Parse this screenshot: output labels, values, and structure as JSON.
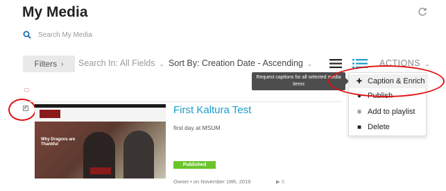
{
  "page": {
    "title": "My Media"
  },
  "search": {
    "placeholder": "Search My Media"
  },
  "toolbar": {
    "filters_label": "Filters",
    "search_in": "Search In: All Fields",
    "sort_by": "Sort By: Creation Date - Ascending",
    "actions_label": "ACTIONS"
  },
  "tooltip": {
    "text": "Request captions for all selected media items"
  },
  "actions_menu": {
    "items": [
      {
        "label": "Caption & Enrich",
        "icon": "plus-icon"
      },
      {
        "label": "Publish",
        "icon": "globe-icon"
      },
      {
        "label": "Add to playlist",
        "icon": "playlist-add-icon"
      },
      {
        "label": "Delete",
        "icon": "trash-icon"
      }
    ]
  },
  "media_entry": {
    "selected": true,
    "title": "First Kaltura Test",
    "description": "first day at MSUM",
    "status": "Published",
    "meta": "Owner • on November 18th, 2019",
    "plays": "5",
    "thumbnail": {
      "headline": "Why Dragons are Thankful"
    }
  },
  "colors": {
    "accent_blue": "#1b9cc9",
    "published_green": "#6ac42a",
    "annotation_red": "#e01010"
  }
}
